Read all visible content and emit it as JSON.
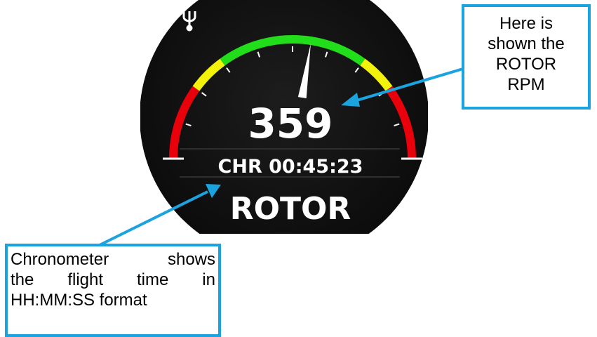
{
  "device": {
    "status_icon": "usb-icon",
    "rpm_value": "359",
    "chronometer_text": "CHR 00:45:23",
    "mode_label": "ROTOR",
    "gauge": {
      "needle_position": 0.55,
      "zones": [
        "red",
        "yellow",
        "green",
        "yellow",
        "red"
      ],
      "colors": {
        "red": "#e8000b",
        "yellow": "#f2f20a",
        "green": "#22dd1a",
        "screen": "#151515"
      }
    }
  },
  "annotations": {
    "rpm_callout": {
      "lines": [
        "Here is",
        "shown the",
        "ROTOR",
        "RPM"
      ]
    },
    "chronometer_callout": {
      "lines": [
        "Chronometer shows",
        "the flight time in",
        "HH:MM:SS format"
      ]
    },
    "accent_color": "#1ba3e0"
  }
}
